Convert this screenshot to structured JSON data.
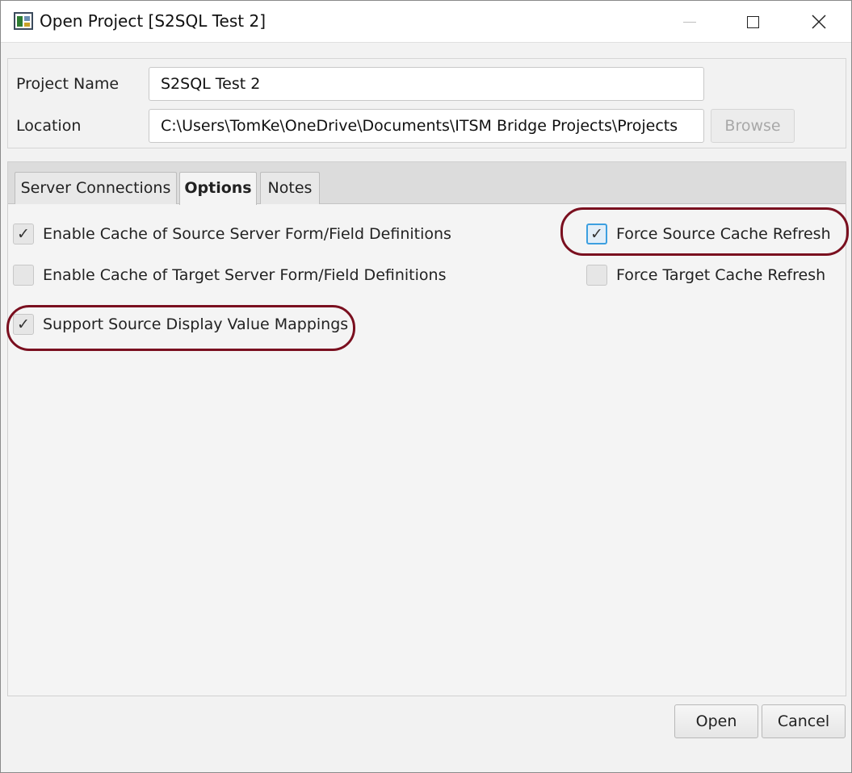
{
  "window": {
    "title": "Open Project [S2SQL Test 2]"
  },
  "project": {
    "name_label": "Project Name",
    "name_value": "S2SQL Test 2",
    "location_label": "Location",
    "location_value": "C:\\Users\\TomKe\\OneDrive\\Documents\\ITSM Bridge Projects\\Projects",
    "browse_label": "Browse"
  },
  "tabs": [
    {
      "label": "Server Connections",
      "active": false
    },
    {
      "label": "Options",
      "active": true
    },
    {
      "label": "Notes",
      "active": false
    }
  ],
  "options": {
    "enable_source_cache": {
      "label": "Enable Cache of Source Server Form/Field Definitions",
      "checked": true
    },
    "enable_target_cache": {
      "label": "Enable Cache of Target Server Form/Field Definitions",
      "checked": false
    },
    "support_display_mappings": {
      "label": "Support Source Display Value Mappings",
      "checked": true
    },
    "force_source_refresh": {
      "label": "Force Source Cache Refresh",
      "checked": true
    },
    "force_target_refresh": {
      "label": "Force Target Cache Refresh",
      "checked": false
    }
  },
  "buttons": {
    "open": "Open",
    "cancel": "Cancel"
  },
  "colors": {
    "highlight": "#7a0f1f",
    "focus": "#3c9fe0"
  }
}
